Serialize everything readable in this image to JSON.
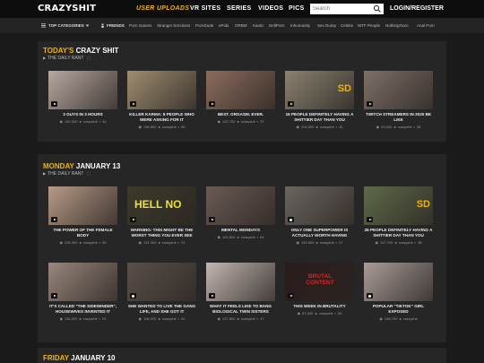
{
  "header": {
    "logo": "CRAZYSHIT",
    "nav": [
      "USER UPLOADS",
      "VR SITES",
      "SERIES",
      "VIDEOS",
      "PICS"
    ],
    "search_placeholder": "Search",
    "login": "LOGIN/REGISTER"
  },
  "subnav": {
    "items": [
      "TOP CATEGORIES",
      "FRIENDS",
      "Porn Games",
      "Stranger Erections",
      "PornDude",
      "ePoki",
      "ORBM",
      "Kaotic",
      "DeltPorn",
      "Inhumanity",
      "Sex Dump",
      "Celebs",
      "WTF People",
      "NothingToxic",
      "Anal Porn"
    ]
  },
  "sections": [
    {
      "title_highlight": "TODAY'S",
      "title_rest": " CRAZY SHIT",
      "subtitle": "THE DAILY RANT",
      "subtitle_count": "",
      "cards": [
        {
          "title": "3 GUYS IN 3 HOURS",
          "views": "149,300",
          "author": "crazyshit",
          "comments": "44",
          "type": "video",
          "color": "#b8a9a0",
          "overlay": ""
        },
        {
          "title": "KILLER KARMA: 8 PEOPLE WHO WERE ASKING FOR IT",
          "views": "136,800",
          "author": "crazyshit",
          "comments": "55",
          "type": "video",
          "color": "#9e8d70",
          "overlay": ""
        },
        {
          "title": "BEST. ORGASM. EVER.",
          "views": "122,700",
          "author": "crazyshit",
          "comments": "37",
          "type": "video",
          "color": "#8c6c5c",
          "overlay": ""
        },
        {
          "title": "16 PEOPLE DEFINITELY HAVING A SHITTIER DAY THAN YOU",
          "views": "204,500",
          "author": "crazyshit",
          "comments": "44",
          "type": "video",
          "color": "#8a8270",
          "overlay": "SD"
        },
        {
          "title": "TWITCH STREAMERS IN 2020 BE LIKE",
          "views": "93,000",
          "author": "crazyshit",
          "comments": "38",
          "type": "video",
          "color": "#7e7068",
          "overlay": ""
        }
      ]
    },
    {
      "title_highlight": "MONDAY",
      "title_rest": " JANUARY 13",
      "subtitle": "THE DAILY RANT",
      "subtitle_count": "",
      "cards": [
        {
          "title": "THE POWER OF THE FEMALE BODY",
          "views": "205,300",
          "author": "crazyshit",
          "comments": "50",
          "type": "video",
          "color": "#b79a86",
          "overlay": ""
        },
        {
          "title": "WARNING: THIS MIGHT BE THE WORST THING YOU EVER SEE",
          "views": "131,300",
          "author": "crazyshit",
          "comments": "91",
          "type": "video",
          "color": "#3c3a2a",
          "overlay": "HELL NO"
        },
        {
          "title": "MENTAL MONDAYS",
          "views": "109,800",
          "author": "crazyshit",
          "comments": "64",
          "type": "video",
          "color": "#6a5a54",
          "overlay": ""
        },
        {
          "title": "ONLY ONE SUPERPOWER IS ACTUALLY WORTH HAVING",
          "views": "154,800",
          "author": "crazyshit",
          "comments": "27",
          "type": "photo",
          "color": "#6b6560",
          "overlay": ""
        },
        {
          "title": "26 PEOPLE DEFINITELY HAVING A SHITTIER DAY THAN YOU",
          "views": "147,700",
          "author": "crazyshit",
          "comments": "38",
          "type": "video",
          "color": "#5e6a4a",
          "overlay": "SD"
        },
        {
          "title": "IT'S CALLED \"THE SIDEWINDER\", HOUSEWIVES INVENTED IT",
          "views": "116,900",
          "author": "crazyshit",
          "comments": "23",
          "type": "video",
          "color": "#9a867c",
          "overlay": ""
        },
        {
          "title": "SHE WANTED TO LIVE THE GANG LIFE, AND SHE GOT IT",
          "views": "108,900",
          "author": "crazyshit",
          "comments": "42",
          "type": "photo",
          "color": "#5a504a",
          "overlay": ""
        },
        {
          "title": "WHAT IT FEELS LIKE TO BANG BIOLOGICAL TWIN SISTERS",
          "views": "137,800",
          "author": "crazyshit",
          "comments": "47",
          "type": "video",
          "color": "#c2b6b0",
          "overlay": ""
        },
        {
          "title": "THIS WEEK IN BRUTALITY",
          "views": "87,300",
          "author": "crazyshit",
          "comments": "59",
          "type": "video",
          "color": "#2a1c1c",
          "overlay": "BRUTAL CONTENT"
        },
        {
          "title": "POPULAR \"TIKTOK\" GIRL EXPOSED",
          "views": "138,700",
          "author": "crazyshit",
          "comments": "",
          "type": "photo",
          "color": "#a89c98",
          "overlay": ""
        }
      ]
    },
    {
      "title_highlight": "FRIDAY",
      "title_rest": " JANUARY 10",
      "subtitle": "",
      "subtitle_count": "",
      "cards": []
    }
  ],
  "colors": {
    "accent": "#f0b400",
    "background": "#1a1a1a",
    "panel": "#262626",
    "topbar": "#0d0d0d"
  }
}
